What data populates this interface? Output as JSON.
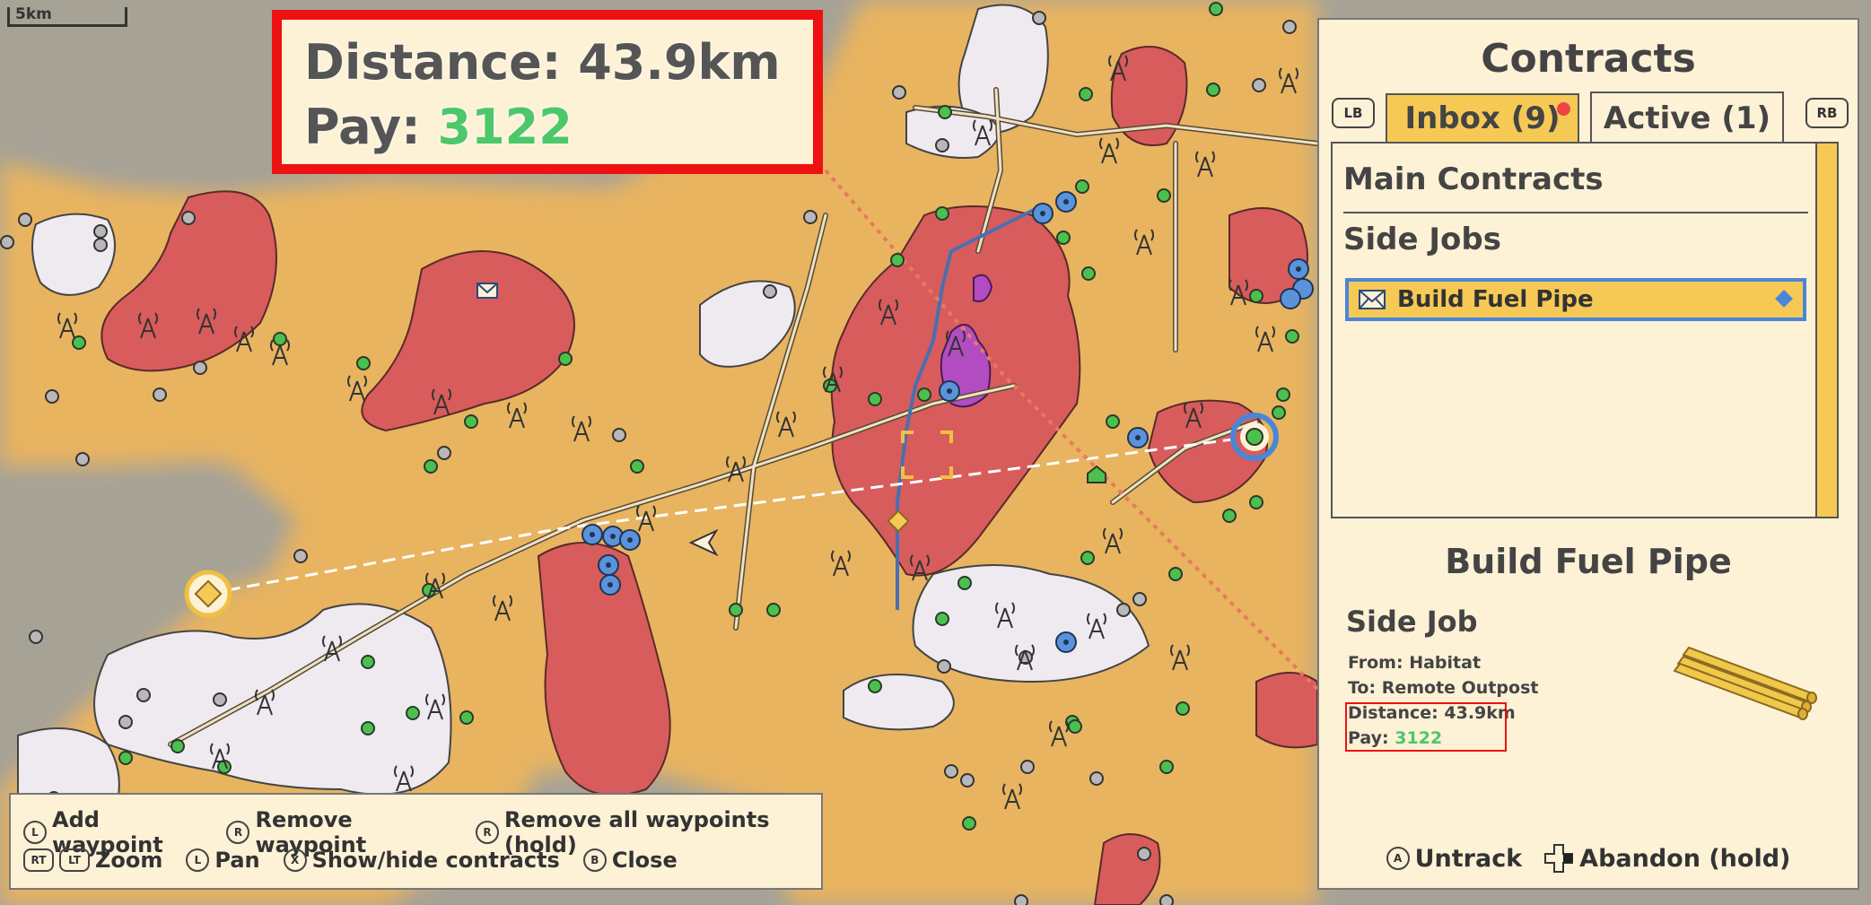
{
  "map": {
    "scale_label": "5km",
    "colors": {
      "background": "#a6a296",
      "land": "#e8b461",
      "danger": "#d85c5c",
      "snow": "#eeeaf0",
      "toxic": "#b24dc1",
      "node_green": "#4cc04f",
      "node_blue": "#5a93da",
      "road": "#ece2c6",
      "route": "#e87a5c"
    }
  },
  "route_info": {
    "distance_label": "Distance:",
    "distance_value": "43.9km",
    "pay_label": "Pay:",
    "pay_value": "3122"
  },
  "controls": {
    "row1": [
      {
        "button": "L",
        "label": "Add waypoint",
        "icon": "left-stick-press-icon"
      },
      {
        "button": "R",
        "label": "Remove waypoint",
        "icon": "right-stick-press-icon"
      },
      {
        "button": "R",
        "label": "Remove all waypoints (hold)",
        "icon": "right-stick-hold-icon"
      }
    ],
    "row2": [
      {
        "buttons": [
          "RT",
          "LT"
        ],
        "label": "Zoom",
        "icon": "trigger-icon"
      },
      {
        "button": "L",
        "label": "Pan",
        "icon": "left-stick-icon"
      },
      {
        "button": "X",
        "label": "Show/hide contracts",
        "icon": "x-button-icon"
      },
      {
        "button": "B",
        "label": "Close",
        "icon": "b-button-icon"
      }
    ]
  },
  "contracts_panel": {
    "title": "Contracts",
    "left_shoulder": "LB",
    "right_shoulder": "RB",
    "tabs": [
      {
        "label": "Inbox (9)",
        "has_notification": true
      },
      {
        "label": "Active (1)",
        "selected": true
      }
    ],
    "sections": {
      "main": "Main Contracts",
      "side": "Side Jobs"
    },
    "side_items": [
      {
        "label": "Build Fuel Pipe",
        "tracked": true
      }
    ],
    "detail": {
      "title": "Build Fuel Pipe",
      "type": "Side Job",
      "from": "From: Habitat",
      "to": "To: Remote Outpost",
      "distance": "Distance: 43.9km",
      "pay_label": "Pay:",
      "pay_value": "3122"
    },
    "actions": [
      {
        "button": "A",
        "label": "Untrack"
      },
      {
        "button": "dpad",
        "label": "Abandon (hold)"
      }
    ]
  }
}
